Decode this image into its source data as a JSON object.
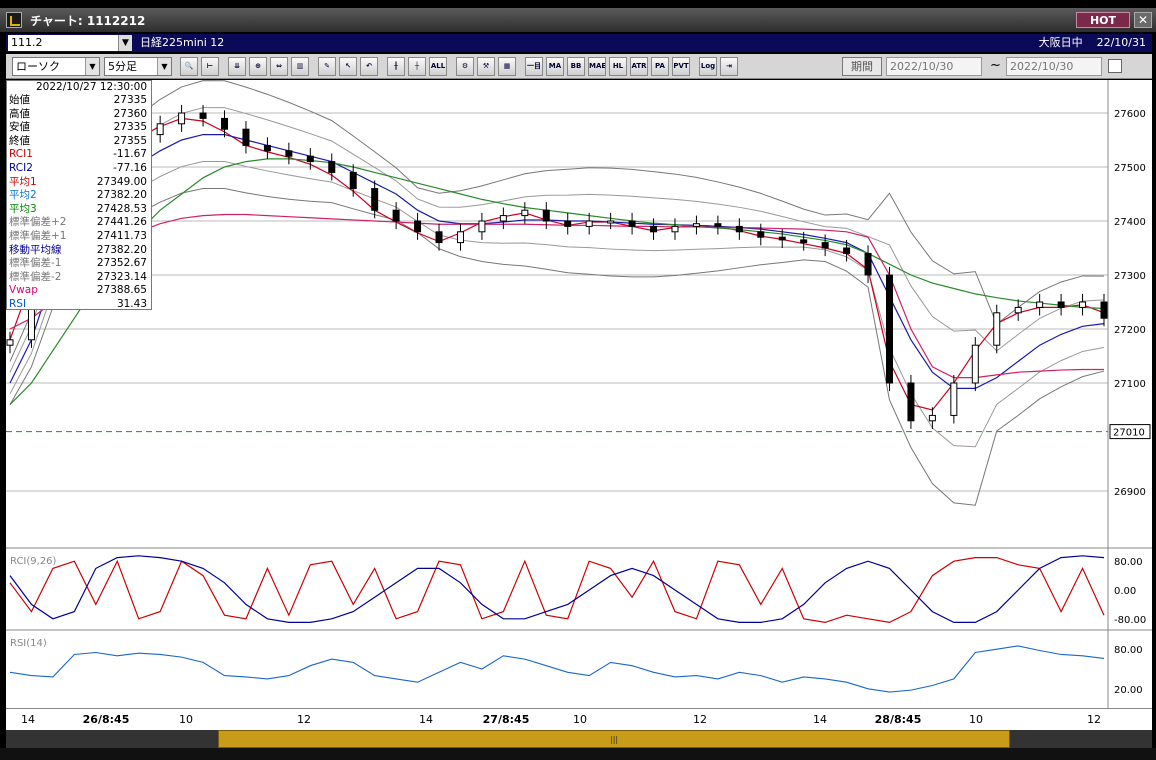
{
  "window": {
    "title": "チャート: 1112212",
    "hot_label": "HOT",
    "close_label": "✕"
  },
  "infobar": {
    "code": "111.2",
    "symbol": "日経225mini 12",
    "market": "大阪日中",
    "date": "22/10/31"
  },
  "toolbar": {
    "chart_type": "ローソク",
    "interval": "5分足",
    "buttons": [
      {
        "name": "zoom",
        "label": "🔍"
      },
      {
        "name": "ruler",
        "label": "⊢"
      },
      {
        "name": "compress",
        "label": "⇊"
      },
      {
        "name": "zoom-fit",
        "label": "⊕"
      },
      {
        "name": "expand",
        "label": "⇔"
      },
      {
        "name": "reset",
        "label": "▥"
      },
      {
        "name": "draw-line",
        "label": "✎"
      },
      {
        "name": "cursor",
        "label": "↖"
      },
      {
        "name": "undo",
        "label": "↶"
      },
      {
        "name": "candle",
        "label": "╫"
      },
      {
        "name": "bar",
        "label": "┼"
      },
      {
        "name": "all",
        "label": "ALL"
      },
      {
        "name": "settings",
        "label": "⚙"
      },
      {
        "name": "tools",
        "label": "⚒"
      },
      {
        "name": "palette",
        "label": "▦"
      },
      {
        "name": "ichimoku",
        "label": "一目"
      },
      {
        "name": "ma",
        "label": "MA"
      },
      {
        "name": "bb",
        "label": "BB"
      },
      {
        "name": "mae",
        "label": "MAE"
      },
      {
        "name": "hl",
        "label": "HL"
      },
      {
        "name": "atr",
        "label": "ATR"
      },
      {
        "name": "para",
        "label": "PA"
      },
      {
        "name": "pvt",
        "label": "PVT"
      },
      {
        "name": "log",
        "label": "Log"
      },
      {
        "name": "export",
        "label": "⇥"
      }
    ],
    "period_label": "期間",
    "date_from": "2022/10/30",
    "date_to": "2022/10/30",
    "tilde": "~"
  },
  "info_panel": {
    "datetime": "2022/10/27  12:30:00",
    "rows": [
      {
        "label": "始値",
        "value": "27335",
        "color": "#000000"
      },
      {
        "label": "高値",
        "value": "27360",
        "color": "#000000"
      },
      {
        "label": "安値",
        "value": "27335",
        "color": "#000000"
      },
      {
        "label": "終値",
        "value": "27355",
        "color": "#000000"
      },
      {
        "label": "RCI1",
        "value": "-11.67",
        "color": "#cc0000"
      },
      {
        "label": "RCI2",
        "value": "-77.16",
        "color": "#000099"
      },
      {
        "label": "平均1",
        "value": "27349.00",
        "color": "#cc0000"
      },
      {
        "label": "平均2",
        "value": "27382.20",
        "color": "#0077dd"
      },
      {
        "label": "平均3",
        "value": "27428.53",
        "color": "#008800"
      },
      {
        "label": "標準偏差+2",
        "value": "27441.26",
        "color": "#777777"
      },
      {
        "label": "標準偏差+1",
        "value": "27411.73",
        "color": "#777777"
      },
      {
        "label": "移動平均線",
        "value": "27382.20",
        "color": "#000099"
      },
      {
        "label": "標準偏差-1",
        "value": "27352.67",
        "color": "#777777"
      },
      {
        "label": "標準偏差-2",
        "value": "27323.14",
        "color": "#777777"
      },
      {
        "label": "Vwap",
        "value": "27388.65",
        "color": "#dd0077"
      },
      {
        "label": "RSI",
        "value": "31.43",
        "color": "#0055cc"
      }
    ]
  },
  "price_axis": {
    "ticks": [
      "27600",
      "27500",
      "27400",
      "27300",
      "27200",
      "27100",
      "26900"
    ],
    "current": "27010"
  },
  "rci_panel": {
    "label": "RCI(9,26)",
    "ticks": [
      "80.00",
      "0.00",
      "-80.00"
    ]
  },
  "rsi_panel": {
    "label": "RSI(14)",
    "ticks": [
      "80.00",
      "20.00"
    ]
  },
  "time_axis": [
    {
      "label": "14",
      "bold": false
    },
    {
      "label": "26/8:45",
      "bold": true
    },
    {
      "label": "10",
      "bold": false
    },
    {
      "label": "12",
      "bold": false
    },
    {
      "label": "14",
      "bold": false
    },
    {
      "label": "27/8:45",
      "bold": true
    },
    {
      "label": "10",
      "bold": false
    },
    {
      "label": "12",
      "bold": false
    },
    {
      "label": "14",
      "bold": false
    },
    {
      "label": "28/8:45",
      "bold": true
    },
    {
      "label": "10",
      "bold": false
    },
    {
      "label": "12",
      "bold": false
    }
  ],
  "chart_data": {
    "type": "line",
    "price_range": [
      26800,
      27650
    ],
    "close": [
      27180,
      27300,
      27420,
      27470,
      27500,
      27540,
      27560,
      27580,
      27600,
      27590,
      27570,
      27540,
      27530,
      27520,
      27510,
      27490,
      27460,
      27420,
      27400,
      27380,
      27360,
      27380,
      27400,
      27410,
      27420,
      27400,
      27390,
      27400,
      27400,
      27390,
      27380,
      27390,
      27395,
      27390,
      27380,
      27370,
      27365,
      27360,
      27350,
      27340,
      27300,
      27100,
      27030,
      27040,
      27100,
      27170,
      27230,
      27240,
      27250,
      27240,
      27250,
      27220
    ],
    "series": [
      {
        "name": "平均1",
        "values": [
          27180,
          27290,
          27400,
          27460,
          27490,
          27530,
          27555,
          27575,
          27590,
          27585,
          27565,
          27540,
          27528,
          27518,
          27505,
          27485,
          27455,
          27420,
          27398,
          27378,
          27362,
          27378,
          27398,
          27408,
          27415,
          27402,
          27392,
          27398,
          27398,
          27390,
          27382,
          27388,
          27392,
          27390,
          27382,
          27372,
          27366,
          27358,
          27350,
          27340,
          27310,
          27140,
          27060,
          27050,
          27100,
          27160,
          27210,
          27230,
          27240,
          27240,
          27245,
          27230
        ]
      },
      {
        "name": "移動平均線",
        "values": [
          27100,
          27180,
          27300,
          27380,
          27430,
          27470,
          27505,
          27530,
          27550,
          27560,
          27560,
          27550,
          27540,
          27530,
          27520,
          27510,
          27490,
          27470,
          27450,
          27420,
          27400,
          27395,
          27395,
          27398,
          27402,
          27402,
          27400,
          27400,
          27398,
          27396,
          27394,
          27393,
          27392,
          27390,
          27388,
          27385,
          27380,
          27375,
          27368,
          27360,
          27340,
          27260,
          27180,
          27120,
          27090,
          27090,
          27110,
          27140,
          27170,
          27190,
          27205,
          27210
        ]
      },
      {
        "name": "平均3",
        "values": [
          27060,
          27100,
          27160,
          27220,
          27280,
          27330,
          27380,
          27420,
          27450,
          27480,
          27500,
          27510,
          27515,
          27515,
          27512,
          27508,
          27500,
          27490,
          27480,
          27470,
          27460,
          27450,
          27440,
          27432,
          27425,
          27420,
          27415,
          27410,
          27405,
          27400,
          27396,
          27393,
          27390,
          27387,
          27384,
          27380,
          27376,
          27370,
          27364,
          27356,
          27340,
          27320,
          27300,
          27285,
          27275,
          27265,
          27258,
          27252,
          27248,
          27244,
          27240,
          27238
        ]
      },
      {
        "name": "Vwap",
        "values": [
          27200,
          27220,
          27250,
          27290,
          27330,
          27360,
          27380,
          27395,
          27405,
          27410,
          27412,
          27412,
          27410,
          27408,
          27406,
          27404,
          27402,
          27400,
          27398,
          27396,
          27394,
          27394,
          27394,
          27394,
          27394,
          27393,
          27392,
          27392,
          27391,
          27390,
          27390,
          27389,
          27389,
          27388,
          27388,
          27387,
          27386,
          27385,
          27383,
          27380,
          27370,
          27300,
          27200,
          27130,
          27110,
          27110,
          27115,
          27120,
          27122,
          27124,
          27125,
          27125
        ]
      }
    ],
    "rci1": [
      20,
      -60,
      60,
      80,
      -40,
      80,
      -80,
      -60,
      80,
      40,
      -70,
      -80,
      60,
      -70,
      70,
      80,
      -40,
      60,
      -80,
      -60,
      80,
      70,
      -80,
      -60,
      80,
      -70,
      -80,
      80,
      60,
      -20,
      80,
      -60,
      -80,
      80,
      70,
      -40,
      60,
      -80,
      -90,
      -70,
      -80,
      -90,
      -60,
      40,
      80,
      90,
      90,
      70,
      60,
      -60,
      60,
      -70
    ],
    "rci2": [
      40,
      -40,
      -80,
      -60,
      60,
      90,
      95,
      90,
      80,
      60,
      20,
      -40,
      -80,
      -90,
      -90,
      -80,
      -60,
      -20,
      20,
      60,
      60,
      20,
      -40,
      -80,
      -80,
      -60,
      -40,
      0,
      40,
      60,
      40,
      0,
      -40,
      -80,
      -90,
      -90,
      -80,
      -40,
      20,
      60,
      80,
      60,
      0,
      -60,
      -90,
      -90,
      -60,
      0,
      60,
      90,
      95,
      90
    ],
    "rsi": [
      45,
      40,
      38,
      72,
      75,
      70,
      74,
      72,
      68,
      60,
      40,
      38,
      35,
      40,
      55,
      65,
      60,
      40,
      35,
      30,
      45,
      60,
      50,
      70,
      65,
      55,
      45,
      40,
      60,
      55,
      45,
      38,
      40,
      35,
      45,
      40,
      30,
      38,
      35,
      30,
      20,
      15,
      18,
      25,
      35,
      75,
      80,
      85,
      78,
      72,
      70,
      66
    ]
  }
}
